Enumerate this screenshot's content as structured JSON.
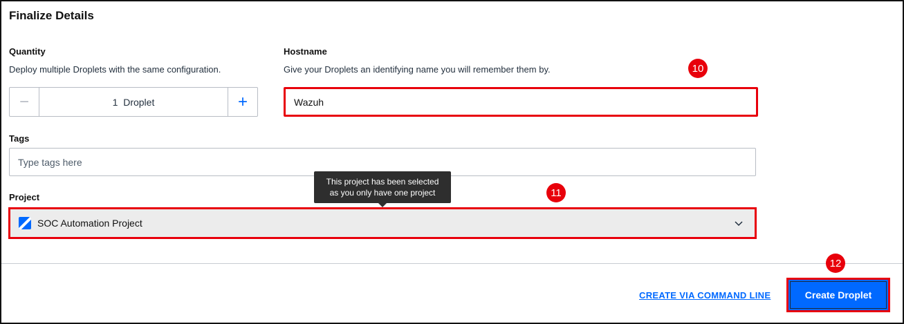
{
  "section": {
    "title": "Finalize Details"
  },
  "quantity": {
    "label": "Quantity",
    "hint": "Deploy multiple Droplets with the same configuration.",
    "minus_symbol": "−",
    "value": "1  Droplet",
    "plus_symbol": "+"
  },
  "hostname": {
    "label": "Hostname",
    "hint": "Give your Droplets an identifying name you will remember them by.",
    "value": "Wazuh"
  },
  "tags": {
    "label": "Tags",
    "placeholder": "Type tags here"
  },
  "project": {
    "label": "Project",
    "tooltip_line1": "This project has been selected",
    "tooltip_line2": "as you only have one project",
    "selected": "SOC Automation Project",
    "icon": "project-icon"
  },
  "footer": {
    "cli_link": "CREATE VIA COMMAND LINE",
    "create_button": "Create Droplet"
  },
  "annotations": {
    "badge_hostname": "10",
    "badge_project": "11",
    "badge_create": "12"
  },
  "colors": {
    "accent": "#0069ff",
    "annotation": "#e8000b",
    "tooltip_bg": "#2e2e2e"
  }
}
